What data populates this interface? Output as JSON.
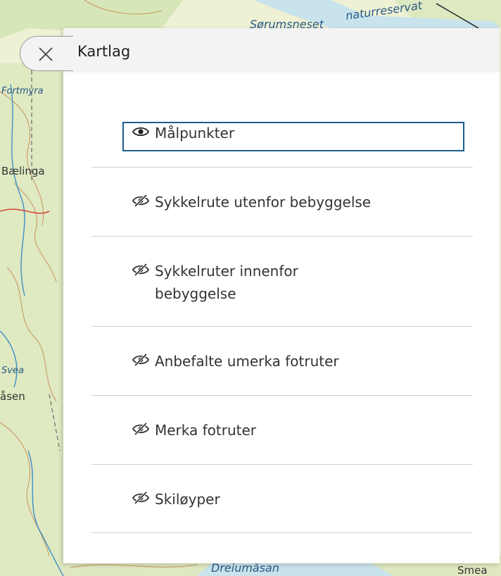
{
  "panel": {
    "title": "Kartlag",
    "close_icon": "close-icon"
  },
  "layers": [
    {
      "label": "Målpunkter",
      "icon": "eye-icon",
      "visible": true,
      "selected": true
    },
    {
      "label": "Sykkelrute utenfor bebyggelse",
      "icon": "eye-slash-icon",
      "visible": false,
      "selected": false
    },
    {
      "label": "Sykkelruter innenfor bebyggelse",
      "icon": "eye-slash-icon",
      "visible": false,
      "selected": false
    },
    {
      "label": "Anbefalte umerka fotruter",
      "icon": "eye-slash-icon",
      "visible": false,
      "selected": false
    },
    {
      "label": "Merka fotruter",
      "icon": "eye-slash-icon",
      "visible": false,
      "selected": false
    },
    {
      "label": "Skiløyper",
      "icon": "eye-slash-icon",
      "visible": false,
      "selected": false
    }
  ],
  "map": {
    "labels": [
      "naturreservat",
      "Sørumsneset",
      "Fortmyra",
      "Bælinga",
      "åsen",
      "Svea",
      "Dreiumåsan",
      "Smea"
    ]
  },
  "colors": {
    "selected_border": "#1b5e8c",
    "header_bg": "#f3f3f3",
    "divider": "#d0d0d0",
    "text": "#333333"
  }
}
